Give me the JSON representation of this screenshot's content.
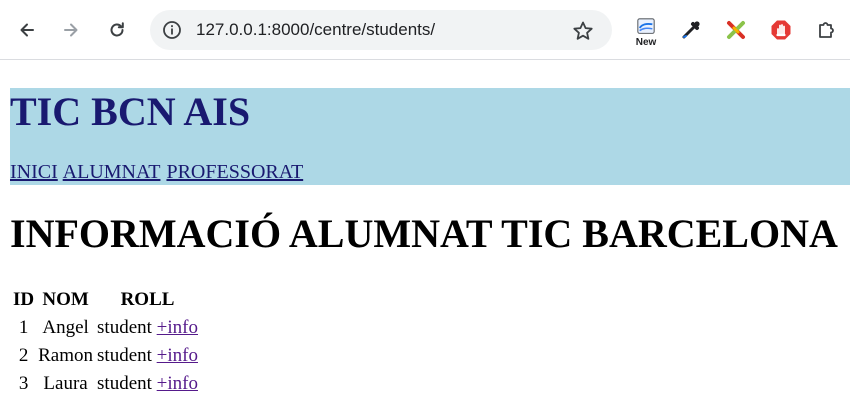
{
  "browser": {
    "url": "127.0.0.1:8000/centre/students/",
    "extension_new_label": "New",
    "icons": [
      "back-arrow-icon",
      "forward-arrow-icon",
      "reload-icon",
      "site-info-icon",
      "bookmark-star-icon",
      "new-extension-icon",
      "eyedropper-icon",
      "cross-extension-icon",
      "stop-hand-icon",
      "puzzle-extensions-icon"
    ]
  },
  "site": {
    "title": "TIC BCN AIS",
    "header_bg": "#add8e6",
    "title_color": "#191970",
    "nav": [
      {
        "label": "INICI"
      },
      {
        "label": "ALUMNAT"
      },
      {
        "label": "PROFESSORAT"
      }
    ]
  },
  "main": {
    "heading": "INFORMACIÓ ALUMNAT TIC BARCELONA",
    "table": {
      "headers": [
        "ID",
        "NOM",
        "ROLL"
      ],
      "rows": [
        {
          "id": "1",
          "name": "Angel",
          "role": "student",
          "link": "+info"
        },
        {
          "id": "2",
          "name": "Ramon",
          "role": "student",
          "link": "+info"
        },
        {
          "id": "3",
          "name": "Laura",
          "role": "student",
          "link": "+info"
        }
      ],
      "link_color": "#551a8b"
    }
  }
}
